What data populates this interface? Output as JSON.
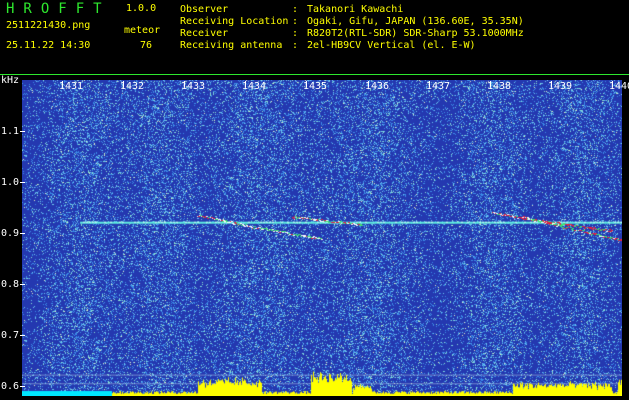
{
  "header": {
    "app_title": "HROFFT",
    "app_version": "1.0.0",
    "file_name": "2511221430.png",
    "date_time": "25.11.22 14:30",
    "observation_label": "meteor",
    "observation_count": "76"
  },
  "station_info": [
    {
      "label": "Observer",
      "colon": ":",
      "value": "Takanori Kawachi"
    },
    {
      "label": "Receiving Location",
      "colon": ":",
      "value": "Ogaki, Gifu, JAPAN (136.60E, 35.35N)"
    },
    {
      "label": "Receiver",
      "colon": ":",
      "value": "R820T2(RTL-SDR) SDR-Sharp 53.1000MHz"
    },
    {
      "label": "Receiving antenna",
      "colon": ":",
      "value": "2el-HB9CV Vertical (el. E-W)"
    }
  ],
  "spectrogram": {
    "y_unit": "kHz",
    "x_ticks": [
      "1431",
      "1432",
      "1433",
      "1434",
      "1435",
      "1436",
      "1437",
      "1438",
      "1439",
      "1440"
    ],
    "y_ticks": [
      "1.1",
      "1.0",
      "0.9",
      "0.8",
      "0.7",
      "0.6"
    ],
    "y_range": [
      0.58,
      1.2
    ],
    "carrier_frequency": 0.92,
    "colors": {
      "background": "#2438b0",
      "noise": "#3c8ee8",
      "carrier": "#60f0e0",
      "echo_strong": "#e02040",
      "echo_mid": "#40e070",
      "power_trace": "#ffff00",
      "baseline": "#00e8ff",
      "axis_text": "#ffffff",
      "header_green": "#2ee82e",
      "header_yellow": "#ffff00"
    }
  }
}
